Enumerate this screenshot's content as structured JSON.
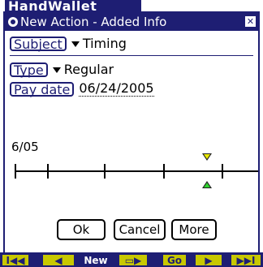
{
  "app": {
    "title": "HandWallet"
  },
  "dialog": {
    "title": "New Action - Added Info",
    "close_symbol": "✕"
  },
  "fields": {
    "subject": {
      "label": "Subject",
      "value": "Timing"
    },
    "type": {
      "label": "Type",
      "value": "Regular"
    },
    "pay_date": {
      "label": "Pay date",
      "value": "06/24/2005"
    }
  },
  "timeline": {
    "period_label": "6/05",
    "markers": [
      {
        "name": "yellow-down-marker",
        "color": "#e8e800"
      },
      {
        "name": "green-up-marker",
        "color": "#2fd22f"
      }
    ]
  },
  "buttons": {
    "ok": "Ok",
    "cancel": "Cancel",
    "more": "More"
  },
  "toolbar": {
    "first": "I◀◀",
    "prev": "◀",
    "new": "New",
    "pen": "▭▶",
    "go": "Go",
    "next": "▶",
    "last": "▶▶I"
  },
  "colors": {
    "accent": "#1e1e73",
    "toolbar_button": "#c8c800"
  }
}
